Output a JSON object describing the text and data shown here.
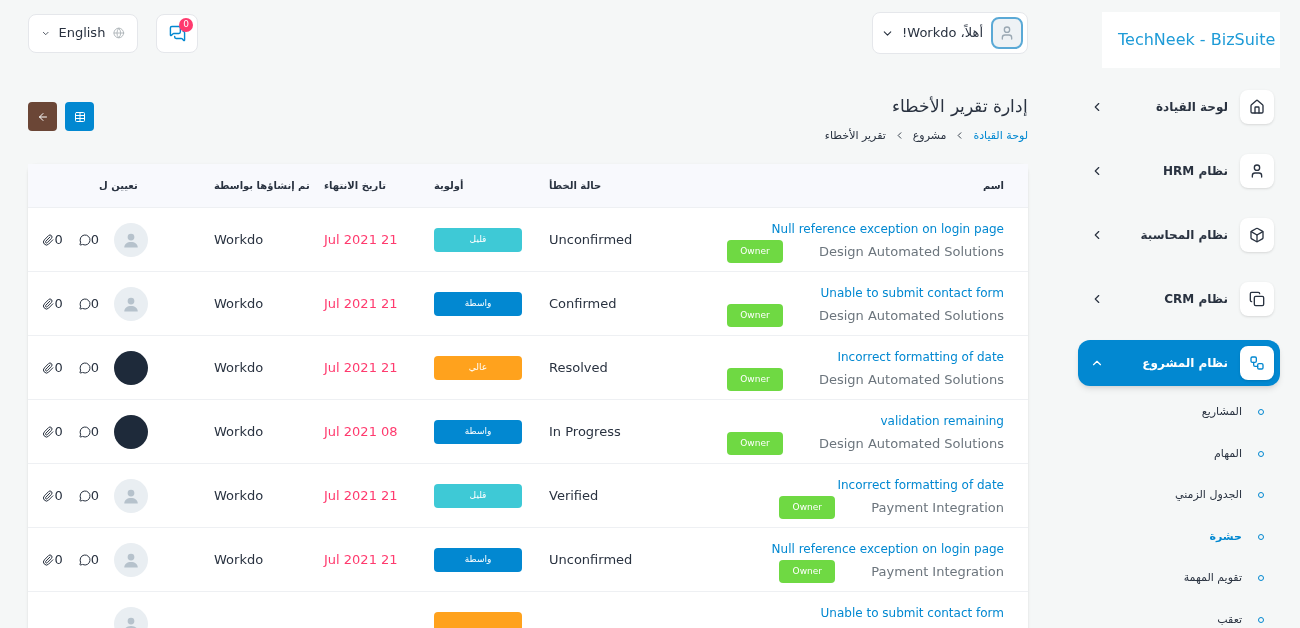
{
  "header": {
    "language": "English",
    "chat_badge": "0",
    "user_greeting": "أهلاً، Workdo!"
  },
  "page": {
    "title": "إدارة تقرير الأخطاء",
    "breadcrumb": [
      {
        "label": "لوحة القيادة",
        "link": true
      },
      {
        "label": "مشروع",
        "link": false
      },
      {
        "label": "تقرير الأخطاء",
        "link": false
      }
    ]
  },
  "table": {
    "columns": [
      "اسم",
      "حالة الخطأ",
      "أولوية",
      "تاريخ الانتهاء",
      "تم إنشاؤها بواسطة",
      "تعيين ل"
    ],
    "rows": [
      {
        "name": "Null reference exception on login page",
        "project": "Design Automated Solutions",
        "role": "Owner",
        "status": "Unconfirmed",
        "priority": {
          "kind": "low",
          "label": "قليل"
        },
        "due": "Jul 2021 21",
        "created_by": "Workdo",
        "assignee": {
          "kind": "placeholder"
        },
        "attachments": "0",
        "comments": "0"
      },
      {
        "name": "Unable to submit contact form",
        "project": "Design Automated Solutions",
        "role": "Owner",
        "status": "Confirmed",
        "priority": {
          "kind": "medium",
          "label": "واسطة"
        },
        "due": "Jul 2021 21",
        "created_by": "Workdo",
        "assignee": {
          "kind": "placeholder"
        },
        "attachments": "0",
        "comments": "0"
      },
      {
        "name": "Incorrect formatting of date",
        "project": "Design Automated Solutions",
        "role": "Owner",
        "status": "Resolved",
        "priority": {
          "kind": "high",
          "label": "عالي"
        },
        "due": "Jul 2021 21",
        "created_by": "Workdo",
        "assignee": {
          "kind": "photo"
        },
        "attachments": "0",
        "comments": "0"
      },
      {
        "name": "validation remaining",
        "project": "Design Automated Solutions",
        "role": "Owner",
        "status": "In Progress",
        "priority": {
          "kind": "medium",
          "label": "واسطة"
        },
        "due": "Jul 2021 08",
        "created_by": "Workdo",
        "assignee": {
          "kind": "photo"
        },
        "attachments": "0",
        "comments": "0"
      },
      {
        "name": "Incorrect formatting of date",
        "project": "Payment Integration",
        "role": "Owner",
        "status": "Verified",
        "priority": {
          "kind": "low",
          "label": "قليل"
        },
        "due": "Jul 2021 21",
        "created_by": "Workdo",
        "assignee": {
          "kind": "placeholder"
        },
        "attachments": "0",
        "comments": "0"
      },
      {
        "name": "Null reference exception on login page",
        "project": "Payment Integration",
        "role": "Owner",
        "status": "Unconfirmed",
        "priority": {
          "kind": "medium",
          "label": "واسطة"
        },
        "due": "Jul 2021 21",
        "created_by": "Workdo",
        "assignee": {
          "kind": "placeholder"
        },
        "attachments": "0",
        "comments": "0"
      },
      {
        "name": "Unable to submit contact form",
        "priority": {
          "kind": "high"
        },
        "assignee": {
          "kind": "placeholder"
        }
      }
    ]
  },
  "sidebar": {
    "logo": "TechNeek - BizSuite",
    "items": [
      {
        "label": "لوحة القيادة",
        "selected": false,
        "expanded": false
      },
      {
        "label": "نظام HRM",
        "selected": false,
        "expanded": false
      },
      {
        "label": "نظام المحاسبة",
        "selected": false,
        "expanded": false
      },
      {
        "label": "نظام CRM",
        "selected": false,
        "expanded": false
      },
      {
        "label": "نظام المشروع",
        "selected": true,
        "expanded": true,
        "children": [
          {
            "label": "المشاريع",
            "selected": false
          },
          {
            "label": "المهام",
            "selected": false
          },
          {
            "label": "الجدول الزمني",
            "selected": false
          },
          {
            "label": "حشرة",
            "selected": true
          },
          {
            "label": "تقويم المهمة",
            "selected": false
          },
          {
            "label": "تعقب",
            "selected": false
          }
        ]
      }
    ]
  }
}
